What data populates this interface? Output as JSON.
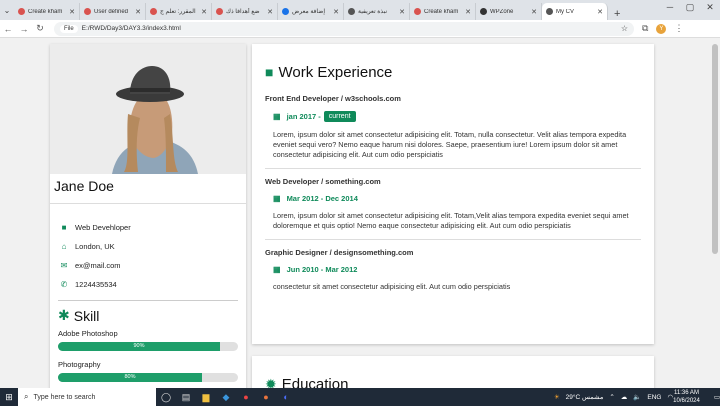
{
  "browser": {
    "tabs": [
      {
        "title": "Create kham",
        "color": "#d9534f"
      },
      {
        "title": "User defined",
        "color": "#d9534f"
      },
      {
        "title": "المقرر: تعلم ج",
        "color": "#d9534f"
      },
      {
        "title": "ضع أهدافاً ذك",
        "color": "#d9534f"
      },
      {
        "title": "إضافة معرض",
        "color": "#1a73e8"
      },
      {
        "title": "نبذة تعريفية",
        "color": "#555"
      },
      {
        "title": "Create kham",
        "color": "#d9534f"
      },
      {
        "title": "WPZone",
        "color": "#333"
      },
      {
        "title": "My CV",
        "color": "#555"
      }
    ],
    "new_tab": "+",
    "url_label": "File",
    "url": "E:/RWD/Day3/DAY3.3/index3.html",
    "profile_initial": "Y"
  },
  "profile": {
    "name": "Jane Doe",
    "job": "Web Devehloper",
    "location": "London, UK",
    "email": "ex@mail.com",
    "phone": "1224435534"
  },
  "skills": {
    "title": "Skill",
    "items": [
      {
        "name": "Adobe Photoshop",
        "percent_label": "90%",
        "percent": 90
      },
      {
        "name": "Photography",
        "percent_label": "80%",
        "percent": 80
      }
    ]
  },
  "work": {
    "title": "Work Experience",
    "jobs": [
      {
        "title": "Front End Developer / w3schools.com",
        "date": "jan 2017 -",
        "badge": "current",
        "desc": "Lorem, ipsum dolor sit amet consectetur adipisicing elit. Totam, nulla consectetur. Velit alias tempora expedita eveniet sequi vero? Nemo eaque harum nisi dolores. Saepe, praesentium iure! Lorem ipsum dolor sit amet consectetur adipisicing elit. Aut cum odio perspiciatis"
      },
      {
        "title": "Web Developer / something.com",
        "date": "Mar 2012 - Dec 2014",
        "badge": "",
        "desc": "Lorem, ipsum dolor sit amet consectetur adipisicing elit. Totam,Velit alias tempora expedita eveniet sequi amet doloremque et quis optio! Nemo eaque consectetur adipisicing elit. Aut cum odio perspiciatis"
      },
      {
        "title": "Graphic Designer / designsomething.com",
        "date": "Jun 2010 - Mar 2012",
        "badge": "",
        "desc": "consectetur sit amet consectetur adipisicing elit. Aut cum odio perspiciatis"
      }
    ]
  },
  "education": {
    "title": "Education"
  },
  "taskbar": {
    "search_placeholder": "Type here to search",
    "weather": "29°C  مشمس",
    "lang": "ENG",
    "time": "11:36 AM",
    "date": "10/6/2024"
  }
}
